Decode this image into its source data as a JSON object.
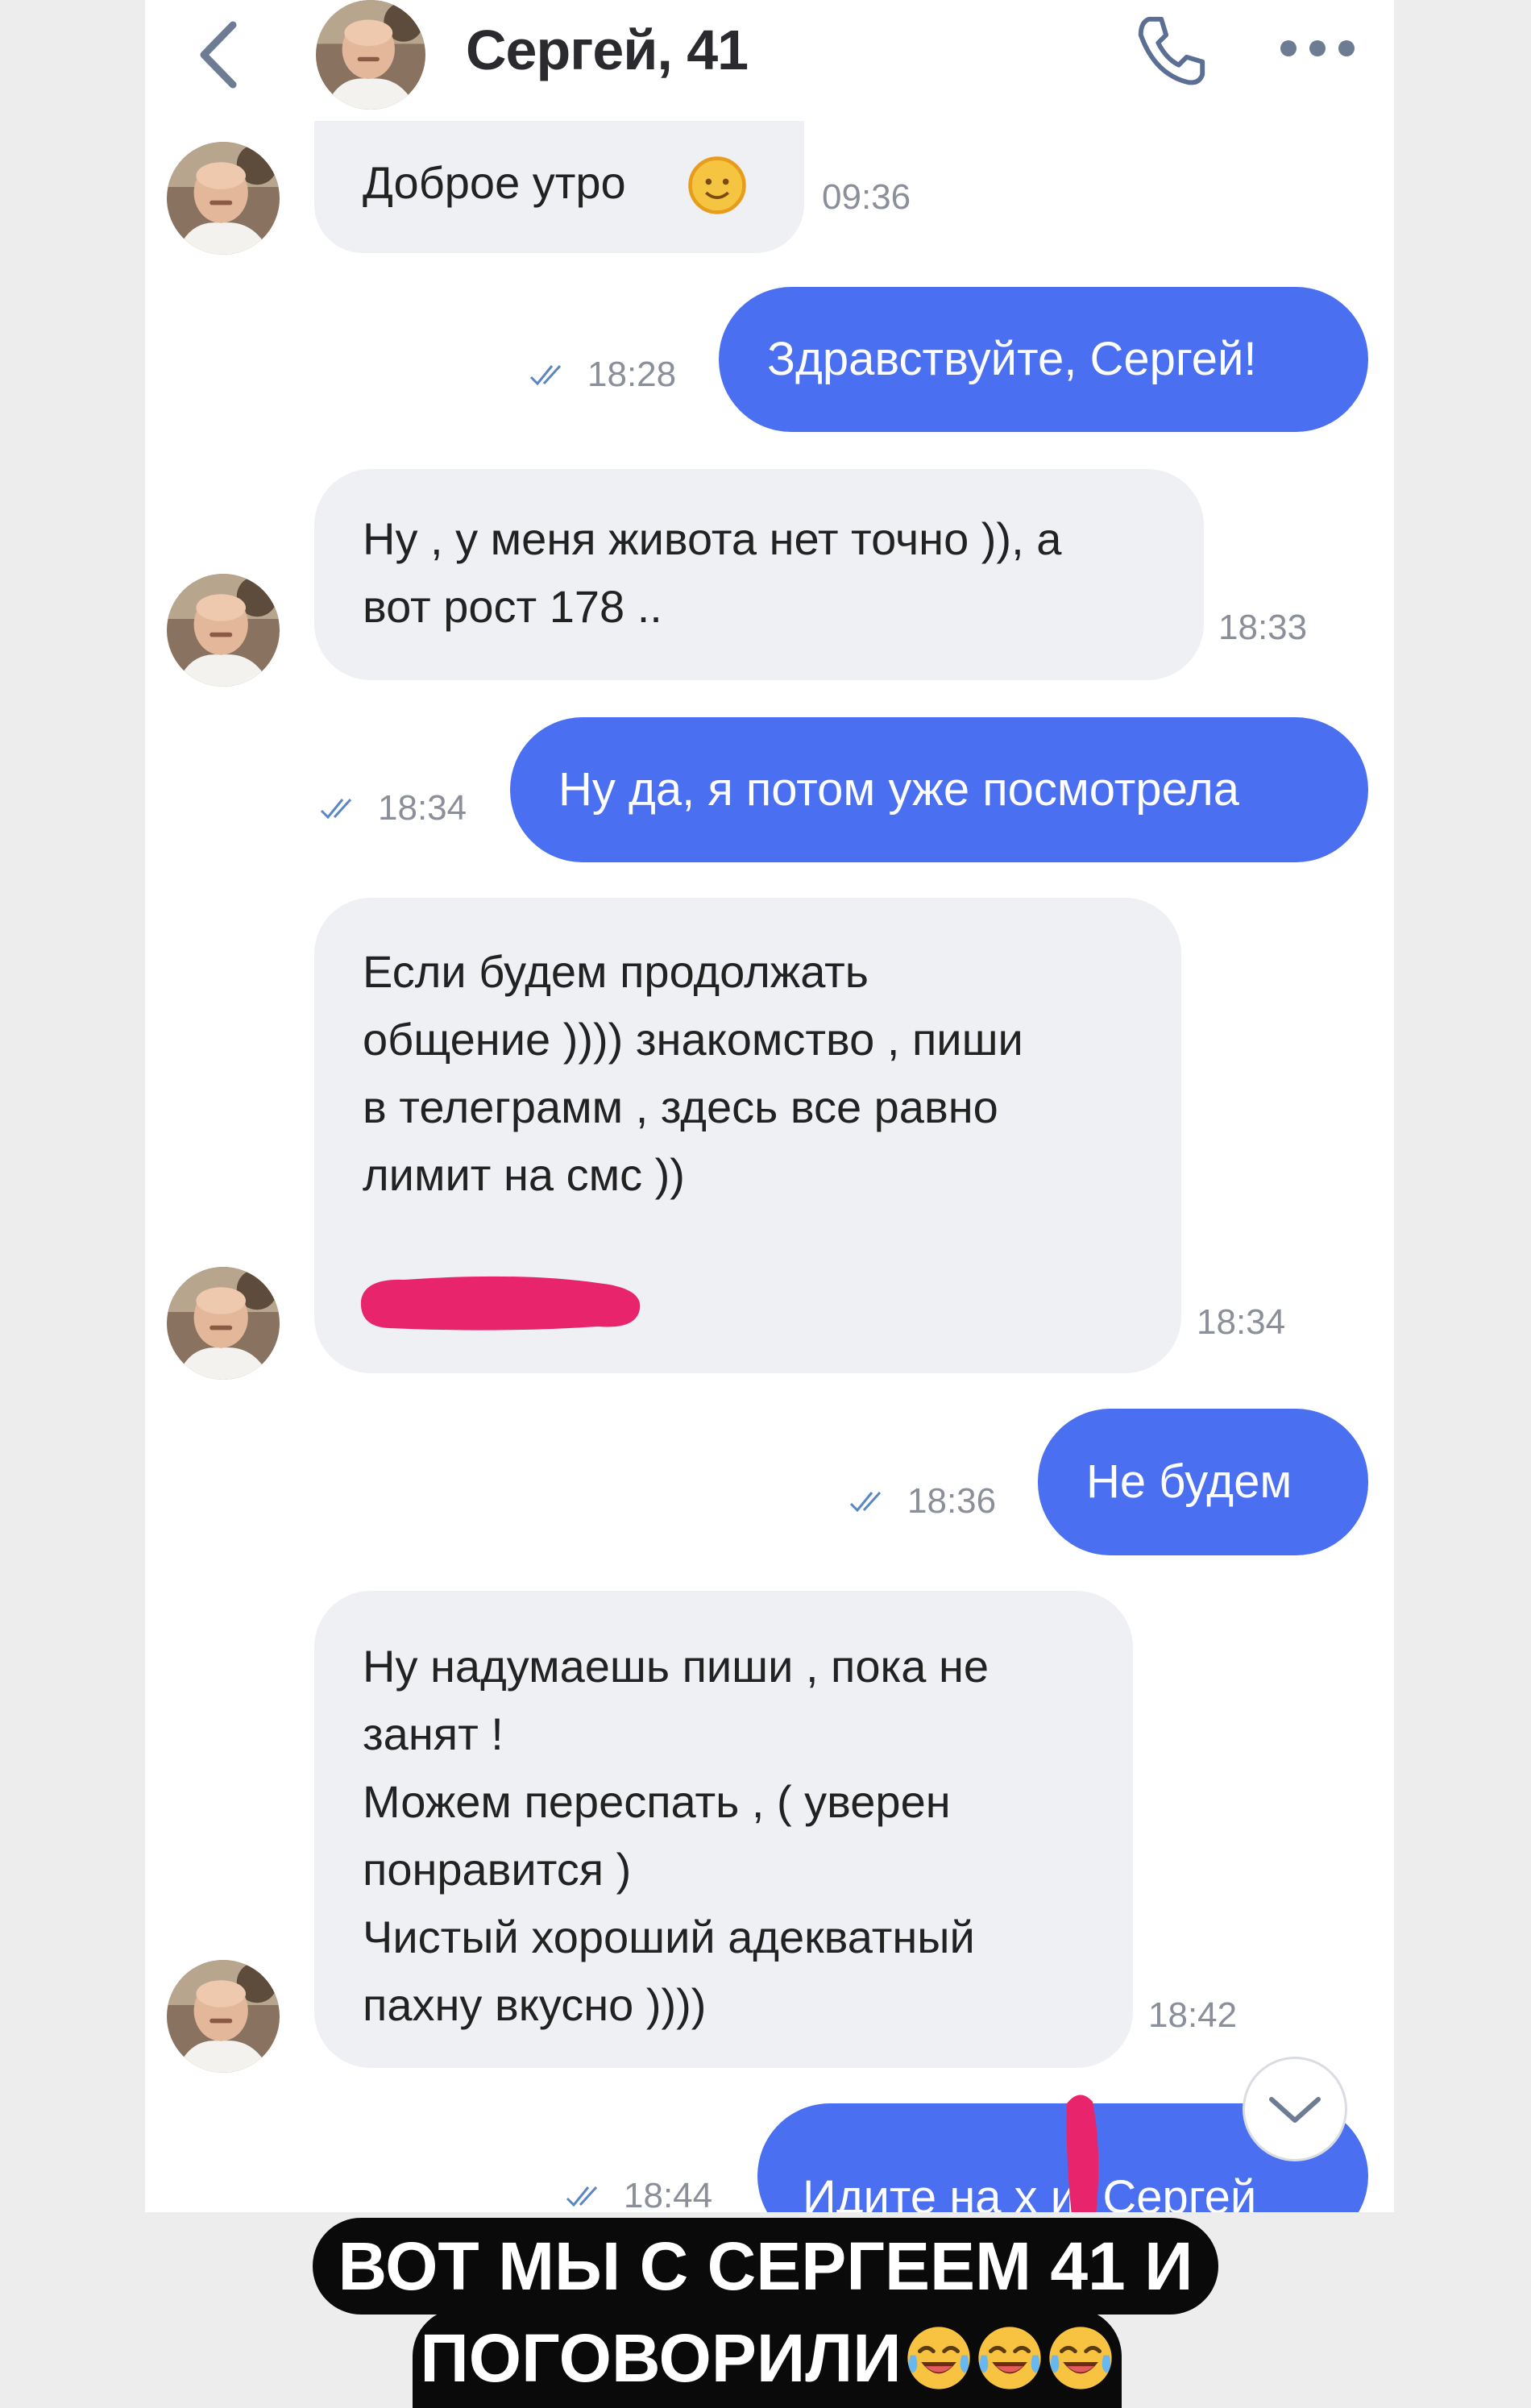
{
  "header": {
    "back_icon": "chevron-left-icon",
    "title": "Сергей, 41",
    "call_icon": "phone-icon",
    "more_icon": "more-horizontal-icon"
  },
  "messages": [
    {
      "direction": "in",
      "text": "Доброе утро",
      "emoji": "sun-face-emoji",
      "time": "09:36"
    },
    {
      "direction": "out",
      "text": "Здравствуйте, Сергей!",
      "time": "18:28",
      "status_icon": "double-check-icon"
    },
    {
      "direction": "in",
      "text": "Ну , у меня живота нет точно )), а\nвот рост 178 ..",
      "time": "18:33"
    },
    {
      "direction": "out",
      "text": "Ну да, я потом уже посмотрела",
      "time": "18:34",
      "status_icon": "double-check-icon"
    },
    {
      "direction": "in",
      "text": "Если будем продолжать\nобщение )))) знакомство , пиши\nв телеграмм , здесь все равно\nлимит на смс ))",
      "redacted": true,
      "time": "18:34"
    },
    {
      "direction": "out",
      "text": "Не будем",
      "time": "18:36",
      "status_icon": "double-check-icon"
    },
    {
      "direction": "in",
      "text": "Ну надумаешь пиши , пока не\nзанят !\nМожем переспать , ( уверен\nпонравится )\nЧистый хороший адекватный\nпахну вкусно ))))",
      "time": "18:42"
    },
    {
      "direction": "out",
      "text": "Идите на х  и, Сергей",
      "time": "18:44",
      "status_icon": "double-check-icon"
    }
  ],
  "scroll_down_icon": "chevron-down-icon",
  "caption": {
    "line1": "ВОТ МЫ С СЕРГЕЕМ 41 И",
    "line2": "ПОГОВОРИЛИ",
    "emoji": "tears-of-joy-emoji"
  },
  "colors": {
    "outgoing_bubble": "#4a6ff0",
    "incoming_bubble": "#eef0f3",
    "redaction_mark": "#e8246c"
  }
}
